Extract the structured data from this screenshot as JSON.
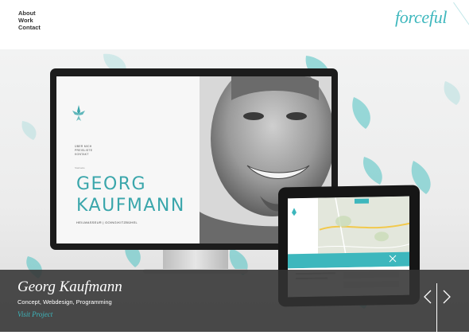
{
  "header": {
    "nav": [
      {
        "label": "About"
      },
      {
        "label": "Work"
      },
      {
        "label": "Contact"
      }
    ],
    "logo_text": "forceful"
  },
  "hero": {
    "monitor_screen": {
      "nav_items": [
        "ÜBER MICH",
        "PREISLISTE",
        "KONTAKT"
      ],
      "tag": "Startseite",
      "name_line1": "GEORG",
      "name_line2": "KAUFMANN",
      "subtitle": "HEILMASSEUR | GOING/KITZBÜHEL"
    },
    "tablet_screen": {
      "map_label": "Kitzbühel"
    }
  },
  "caption": {
    "title": "Georg Kaufmann",
    "tags": "Concept, Webdesign, Programming",
    "link": "Visit Project"
  },
  "colors": {
    "accent": "#3db7bd",
    "caption_bg": "#333333",
    "text_dark": "#333333"
  },
  "icons": {
    "prev": "chevron-left-icon",
    "next": "chevron-right-icon"
  }
}
